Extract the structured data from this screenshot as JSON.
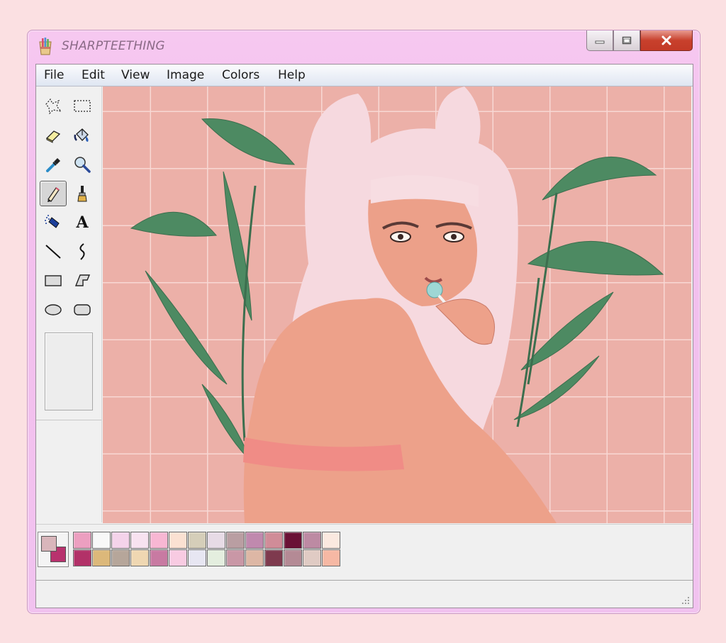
{
  "window": {
    "title": "SHARPTEETHING"
  },
  "title_controls": {
    "minimize": "minimize-icon",
    "maximize": "maximize-icon",
    "close": "close-icon"
  },
  "menu": [
    {
      "label": "File"
    },
    {
      "label": "Edit"
    },
    {
      "label": "View"
    },
    {
      "label": "Image"
    },
    {
      "label": "Colors"
    },
    {
      "label": "Help"
    }
  ],
  "tools": [
    {
      "name": "free-form-select-icon"
    },
    {
      "name": "rect-select-icon"
    },
    {
      "name": "eraser-icon"
    },
    {
      "name": "fill-bucket-icon"
    },
    {
      "name": "color-picker-icon"
    },
    {
      "name": "magnifier-icon"
    },
    {
      "name": "pencil-icon",
      "selected": true
    },
    {
      "name": "brush-icon"
    },
    {
      "name": "airbrush-icon"
    },
    {
      "name": "text-icon",
      "glyph": "A"
    },
    {
      "name": "line-icon"
    },
    {
      "name": "curve-icon"
    },
    {
      "name": "rectangle-icon"
    },
    {
      "name": "polygon-icon"
    },
    {
      "name": "ellipse-icon"
    },
    {
      "name": "rounded-rect-icon"
    }
  ],
  "current_colors": {
    "foreground": "#d9b6bb",
    "background": "#b8326e"
  },
  "palette": [
    "#ec9fc0",
    "#f8f8f8",
    "#f4d3ea",
    "#f8e2f0",
    "#f8b7d3",
    "#fbe1d2",
    "#d5ceb9",
    "#e7dbe6",
    "#b99ea2",
    "#c089ae",
    "#d08c98",
    "#6a1236",
    "#bd8aa3",
    "#fbe9e0",
    "#b23168",
    "#dcb87a",
    "#b6a69a",
    "#efd7b2",
    "#c87aa2",
    "#f8cbe2",
    "#e7e6f2",
    "#e4eedf",
    "#c997a6",
    "#ddb7a5",
    "#7e3a4e",
    "#b48a95",
    "#e0cbc4",
    "#f6b8a4"
  ],
  "colors": {
    "canvas_bg": "#ecb0a8",
    "accent_titlebar": "#f3c4ef"
  }
}
